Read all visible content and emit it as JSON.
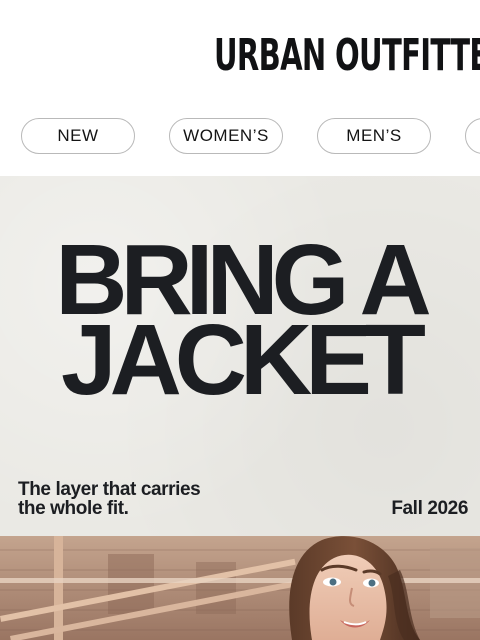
{
  "header": {
    "logo_text": "URBAN OUTFITTERS"
  },
  "nav": {
    "items": [
      {
        "label": "NEW"
      },
      {
        "label": "WOMEN’S"
      },
      {
        "label": "MEN’S"
      },
      {
        "label": ""
      }
    ]
  },
  "hero": {
    "headline_line1": "BRING A",
    "headline_line2": "JACKET",
    "subcopy_line1": "The layer that carries",
    "subcopy_line2": "the whole fit.",
    "season": "Fall 2026"
  },
  "colors": {
    "hero_background": "#eae9e4",
    "text": "#1c1e22",
    "pill_border": "#b9b9b9"
  }
}
